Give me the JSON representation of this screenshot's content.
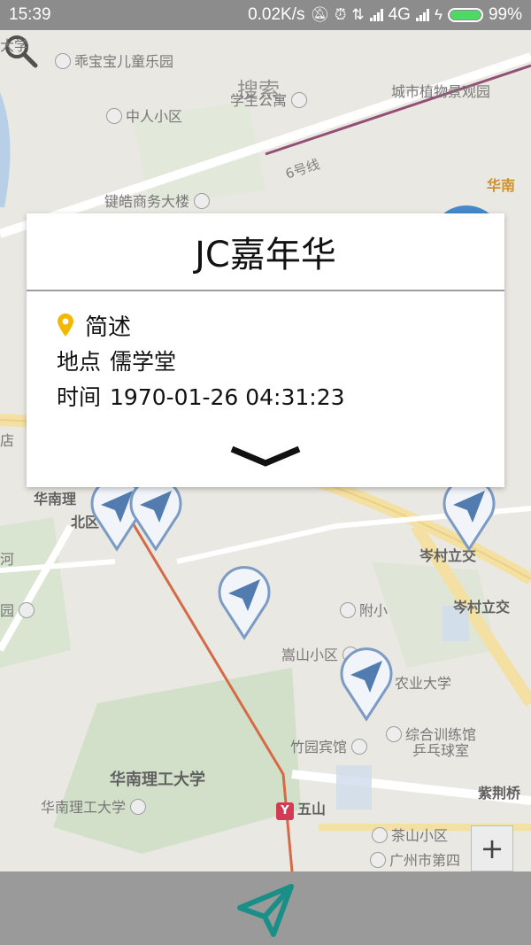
{
  "status_bar": {
    "time": "15:39",
    "network_speed": "0.02K/s",
    "network_type": "4G",
    "battery": "99%",
    "battery_level": 0.99
  },
  "map": {
    "search_hint": "搜索",
    "labels": {
      "top_left_edge": "大学",
      "kindergarten": "乖宝宝儿童乐园",
      "apartment": "学生公寓",
      "botanical": "城市植物景观园",
      "zhongren": "中人小区",
      "line6": "6号线",
      "jianhao": "键皓商务大楼",
      "huanan_right_top": "华南",
      "huanan_left": "华南理",
      "beiqu": "北区",
      "cen_cun_1": "岑村立交",
      "cen_cun_2": "岑村立交",
      "fuxiao": "附小",
      "songshan": "嵩山小区",
      "nongye": "农业大学",
      "zhuyuan": "竹园宾馆",
      "training_1": "综合训练馆",
      "training_2": "乒乓球室",
      "scut_big": "华南理工大学",
      "scut_small": "华南理工大学",
      "wushan": "五山",
      "zijingqiao": "紫荆桥",
      "chashan": "茶山小区",
      "guangzhou_city": "广州市第四",
      "left_he": "河",
      "left_dian": "店",
      "yuan": "园"
    },
    "zoom_in": "+"
  },
  "popup": {
    "title": "JC嘉年华",
    "section_title": "简述",
    "location_label": "地点",
    "location_value": "儒学堂",
    "time_label": "时间",
    "time_value": "1970-01-26 04:31:23"
  },
  "colors": {
    "accent_teal": "#1a8f87",
    "marker_blue": "#2c5f9e",
    "pin_yellow": "#f5b800"
  }
}
